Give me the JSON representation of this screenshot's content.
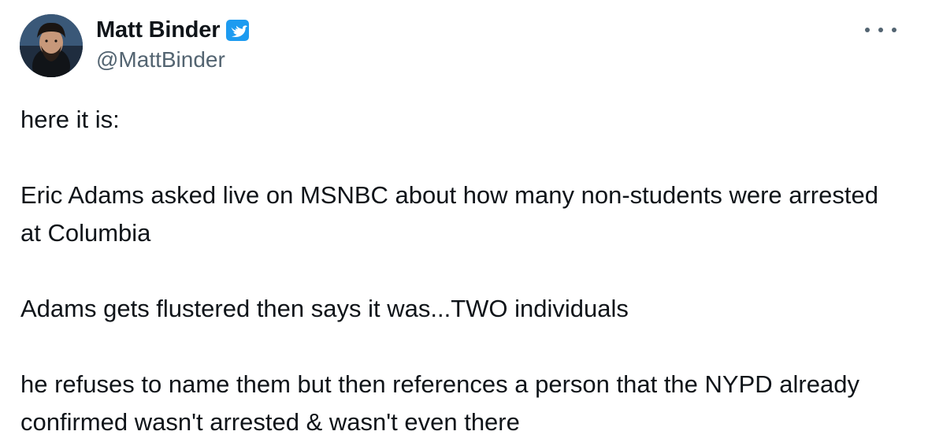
{
  "author": {
    "display_name": "Matt Binder",
    "handle": "@MattBinder",
    "verified": true,
    "verified_icon": "verified-badge-icon",
    "verified_color": "#1d9bf0"
  },
  "actions": {
    "more_icon": "more-horizontal-icon"
  },
  "tweet": {
    "paragraphs": [
      "here it is:",
      "Eric Adams asked live on MSNBC about how many non-students were arrested at Columbia",
      "Adams gets flustered then says it was...TWO individuals",
      "he refuses to name them but then references a person that the NYPD already confirmed wasn't arrested & wasn't even there"
    ]
  },
  "colors": {
    "text": "#0f1419",
    "secondary": "#536471",
    "accent": "#1d9bf0"
  }
}
